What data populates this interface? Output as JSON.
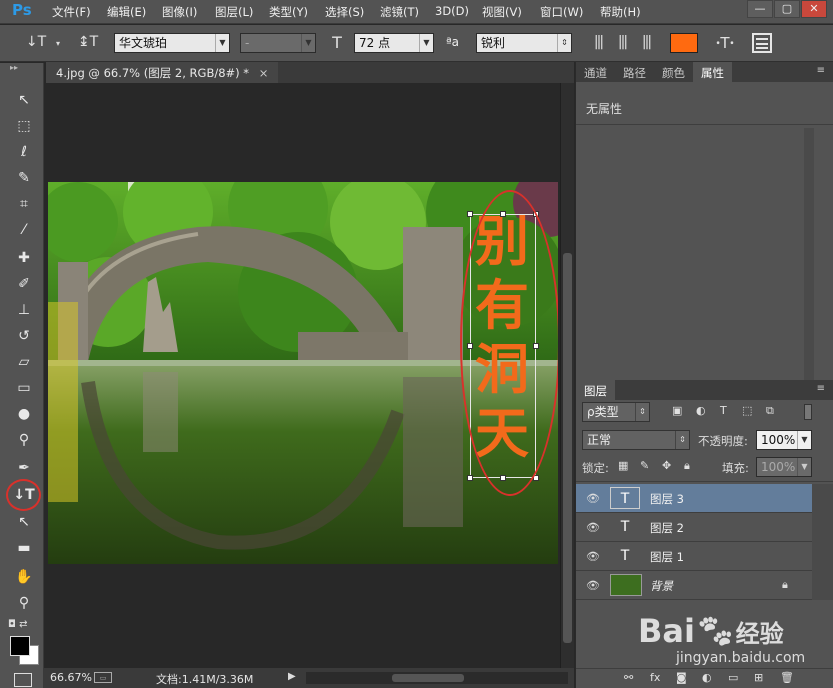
{
  "app": {
    "logo": "Ps"
  },
  "menu": [
    "文件(F)",
    "编辑(E)",
    "图像(I)",
    "图层(L)",
    "类型(Y)",
    "选择(S)",
    "滤镜(T)",
    "3D(D)",
    "视图(V)",
    "窗口(W)",
    "帮助(H)"
  ],
  "window_controls": {
    "minimize": "—",
    "maximize": "▢",
    "close": "✕"
  },
  "options": {
    "font_family": "华文琥珀",
    "font_style": "-",
    "font_size": "72 点",
    "aa_label": "ªa",
    "antialias": "锐利",
    "text_color": "#ff6a10"
  },
  "document": {
    "tab_title": "4.jpg @ 66.7% (图层 2, RGB/8#) *",
    "tab_close": "×",
    "canvas_text": [
      "别",
      "有",
      "洞",
      "天"
    ],
    "canvas_text_color": "#f26a1b",
    "annotation_color": "#d9312b"
  },
  "status": {
    "zoom": "66.67%",
    "doc_info": "文档:1.41M/3.36M",
    "arrow": "▶"
  },
  "properties_panel": {
    "tabs": [
      "通道",
      "路径",
      "颜色",
      "属性"
    ],
    "active_tab": "属性",
    "content": "无属性"
  },
  "layers_panel": {
    "tab": "图层",
    "filter_kind": "ρ类型",
    "blend_mode": "正常",
    "opacity_label": "不透明度:",
    "opacity_value": "100%",
    "lock_label": "锁定:",
    "fill_label": "填充:",
    "fill_value": "100%",
    "layers": [
      {
        "name": "图层 3",
        "type": "text",
        "selected": true
      },
      {
        "name": "图层 2",
        "type": "text",
        "selected": false
      },
      {
        "name": "图层 1",
        "type": "text",
        "selected": false
      },
      {
        "name": "背景",
        "type": "image",
        "selected": false
      }
    ]
  },
  "watermark": {
    "brand": "Bai",
    "brand2": "经验",
    "url": "jingyan.baidu.com"
  }
}
